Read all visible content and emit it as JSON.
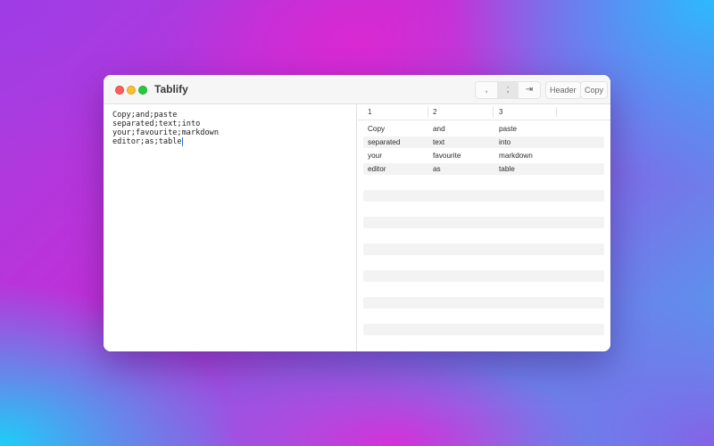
{
  "window": {
    "title": "Tablify"
  },
  "toolbar": {
    "separators": [
      {
        "label": ",",
        "active": false
      },
      {
        "label": ";",
        "active": true
      },
      {
        "label": "⇥",
        "active": false
      }
    ],
    "header_label": "Header",
    "copy_label": "Copy"
  },
  "editor": {
    "lines": [
      "Copy;and;paste",
      "separated;text;into",
      "your;favourite;markdown",
      "editor;as;table"
    ]
  },
  "table": {
    "headers": [
      "1",
      "2",
      "3"
    ],
    "rows": [
      [
        "Copy",
        "and",
        "paste"
      ],
      [
        "separated",
        "text",
        "into"
      ],
      [
        "your",
        "favourite",
        "markdown"
      ],
      [
        "editor",
        "as",
        "table"
      ]
    ]
  },
  "colors": {
    "close": "#fe5f57",
    "minimize": "#febc2e",
    "zoom": "#28c840",
    "caret": "#2a6fdb"
  }
}
